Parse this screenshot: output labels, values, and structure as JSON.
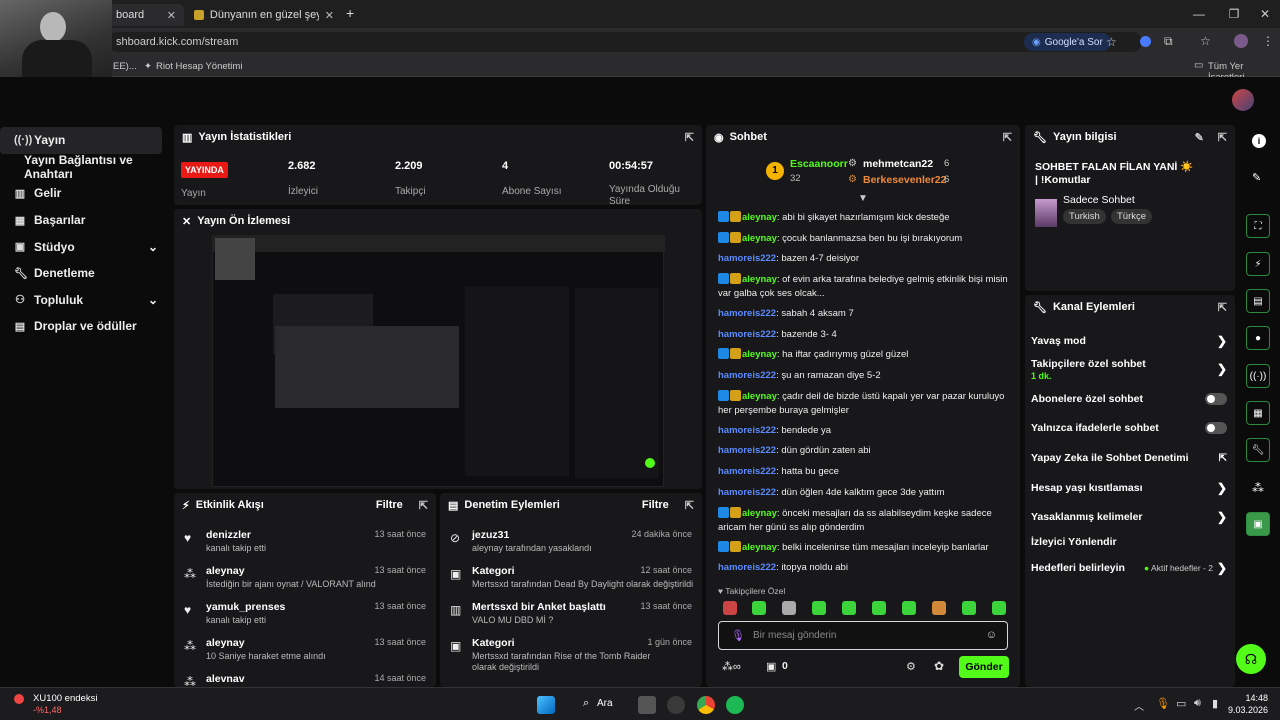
{
  "browser": {
    "tabs": [
      {
        "label": "board"
      },
      {
        "label": "Dünyanın en güzel şeyi - Tier L"
      }
    ],
    "new_tab": "+",
    "url": "shboard.kick.com/stream",
    "google_btn": "Google'a Sor",
    "bookmarks": [
      {
        "label": "EE)..."
      },
      {
        "label": "Riot Hesap Yönetimi"
      }
    ],
    "all_bookmarks": "Tüm Yer İşaretleri"
  },
  "sidebar": {
    "items": [
      {
        "label": "Yayın",
        "icon": "broadcast-icon"
      },
      {
        "label": "Yayın Bağlantısı ve Anahtarı",
        "icon": ""
      },
      {
        "label": "Gelir",
        "icon": "chart-icon"
      },
      {
        "label": "Başarılar",
        "icon": "grid-icon"
      },
      {
        "label": "Stüdyo",
        "icon": "studio-icon"
      },
      {
        "label": "Denetleme",
        "icon": "wrench-icon"
      },
      {
        "label": "Topluluk",
        "icon": "people-icon"
      },
      {
        "label": "Droplar ve ödüller",
        "icon": "gift-icon"
      }
    ]
  },
  "stats": {
    "title": "Yayın İstatistikleri",
    "live_badge": "YAYINDA",
    "live_label": "Yayın",
    "items": [
      {
        "value": "2.682",
        "label": "İzleyici"
      },
      {
        "value": "2.209",
        "label": "Takipçi"
      },
      {
        "value": "4",
        "label": "Abone Sayısı"
      },
      {
        "value": "00:54:57",
        "label": "Yayında Olduğu Süre"
      }
    ]
  },
  "preview": {
    "title": "Yayın Ön İzlemesi"
  },
  "activity": {
    "title": "Etkinlik Akışı",
    "filter": "Filtre",
    "events": [
      {
        "name": "denizzler",
        "desc": "kanalı takip etti",
        "time": "13 saat önce"
      },
      {
        "name": "aleynay",
        "desc": "İstediğin bir ajanı oynat / VALORANT alındı",
        "time": "13 saat önce"
      },
      {
        "name": "yamuk_prenses",
        "desc": "kanalı takip etti",
        "time": "13 saat önce"
      },
      {
        "name": "aleynay",
        "desc": "10 Saniye haraket etme alındı",
        "time": "13 saat önce"
      },
      {
        "name": "alevnav",
        "desc": "",
        "time": "14 saat önce"
      }
    ]
  },
  "moderation": {
    "title": "Denetim Eylemleri",
    "filter": "Filtre",
    "events": [
      {
        "name": "jezuz31",
        "desc": "aleynay tarafından yasaklandı",
        "time": "24 dakika önce"
      },
      {
        "name": "Kategori",
        "desc": "Mertssxd tarafından Dead By Daylight olarak değiştirildi",
        "time": "12 saat önce"
      },
      {
        "name": "Mertssxd bir Anket başlattı",
        "desc": "VALO MU DBD Mİ ?",
        "time": "13 saat önce"
      },
      {
        "name": "Kategori",
        "desc": "Mertssxd tarafından Rise of the Tomb Raider olarak değiştirildi",
        "time": "1 gün önce"
      }
    ]
  },
  "chat": {
    "title": "Sohbet",
    "top": {
      "rank1_name": "Escaanoorr",
      "rank1_count": "32",
      "rank1_num": "1",
      "p2": "mehmetcan22",
      "p2_count": "6",
      "p3": "Berkesevenler22",
      "p3_count": "6"
    },
    "messages": [
      {
        "user": "aleynay",
        "text": ": abi bi şikayet hazırlamışım kick desteğe"
      },
      {
        "user": "aleynay",
        "text": ": çocuk banlanmazsa ben bu işi bırakıyorum"
      },
      {
        "user": "hamoreis222",
        "text": ": bazen 4-7 deisiyor"
      },
      {
        "user": "aleynay",
        "text": ": of evin arka tarafına belediye gelmiş etkinlik bişi misin var galba çok ses olcak..."
      },
      {
        "user": "hamoreis222",
        "text": ": sabah 4 aksam 7"
      },
      {
        "user": "hamoreis222",
        "text": ": bazende 3- 4"
      },
      {
        "user": "aleynay",
        "text": ": ha iftar çadırıymış güzel güzel"
      },
      {
        "user": "hamoreis222",
        "text": ": şu an ramazan diye 5-2"
      },
      {
        "user": "aleynay",
        "text": ": çadır deil de bizde üstü kapalı yer var pazar kuruluyo her perşembe buraya gelmişler"
      },
      {
        "user": "hamoreis222",
        "text": ": bendede ya"
      },
      {
        "user": "hamoreis222",
        "text": ": dün gördün zaten abi"
      },
      {
        "user": "hamoreis222",
        "text": ": hatta bu gece"
      },
      {
        "user": "hamoreis222",
        "text": ": dün öğlen 4de kalktım gece 3de yattım"
      },
      {
        "user": "aleynay",
        "text": ": önceki mesajları da ss alabilseydim keşke sadece aricam her günü ss alıp gönderdim"
      },
      {
        "user": "aleynay",
        "text": ": belki incelenirse tüm mesajları inceleyip banlarlar"
      },
      {
        "user": "hamoreis222",
        "text": ": itopya noldu abi"
      }
    ],
    "followers_only": "Takipçilere Özel",
    "input_placeholder": "Bir mesaj gönderin",
    "points": "0",
    "send": "Gönder"
  },
  "stream_info": {
    "title": "Yayın bilgisi",
    "stream_title": "SOHBET FALAN FİLAN YANİ ☀️ | !Komutlar",
    "category": "Sadece Sohbet",
    "tags": [
      "Turkish",
      "Türkçe"
    ]
  },
  "channel_actions": {
    "title": "Kanal Eylemleri",
    "items": [
      {
        "label": "Yavaş mod",
        "sub": "",
        "ctrl": "arrow"
      },
      {
        "label": "Takipçilere özel sohbet",
        "sub": "1 dk.",
        "ctrl": "arrow"
      },
      {
        "label": "Abonelere özel sohbet",
        "sub": "",
        "ctrl": "toggle"
      },
      {
        "label": "Yalnızca ifadelerle sohbet",
        "sub": "",
        "ctrl": "toggle"
      },
      {
        "label": "Yapay Zeka ile Sohbet Denetimi",
        "sub": "",
        "ctrl": "ext"
      },
      {
        "label": "Hesap yaşı kısıtlaması",
        "sub": "",
        "ctrl": "arrow"
      },
      {
        "label": "Yasaklanmış kelimeler",
        "sub": "",
        "ctrl": "arrow"
      },
      {
        "label": "İzleyici Yönlendir",
        "sub": "",
        "ctrl": ""
      },
      {
        "label": "Hedefleri belirleyin",
        "sub": "Aktif hedefler - 2",
        "ctrl": "arrow"
      }
    ]
  },
  "taskbar": {
    "ticker_name": "XU100 endeksi",
    "ticker_value": "-%1,48",
    "search": "Ara",
    "time": "14:48",
    "date": "9.03.2026"
  },
  "colors": {
    "accent": "#53fc18",
    "live": "#e91916",
    "mention": "#5b8bff"
  }
}
